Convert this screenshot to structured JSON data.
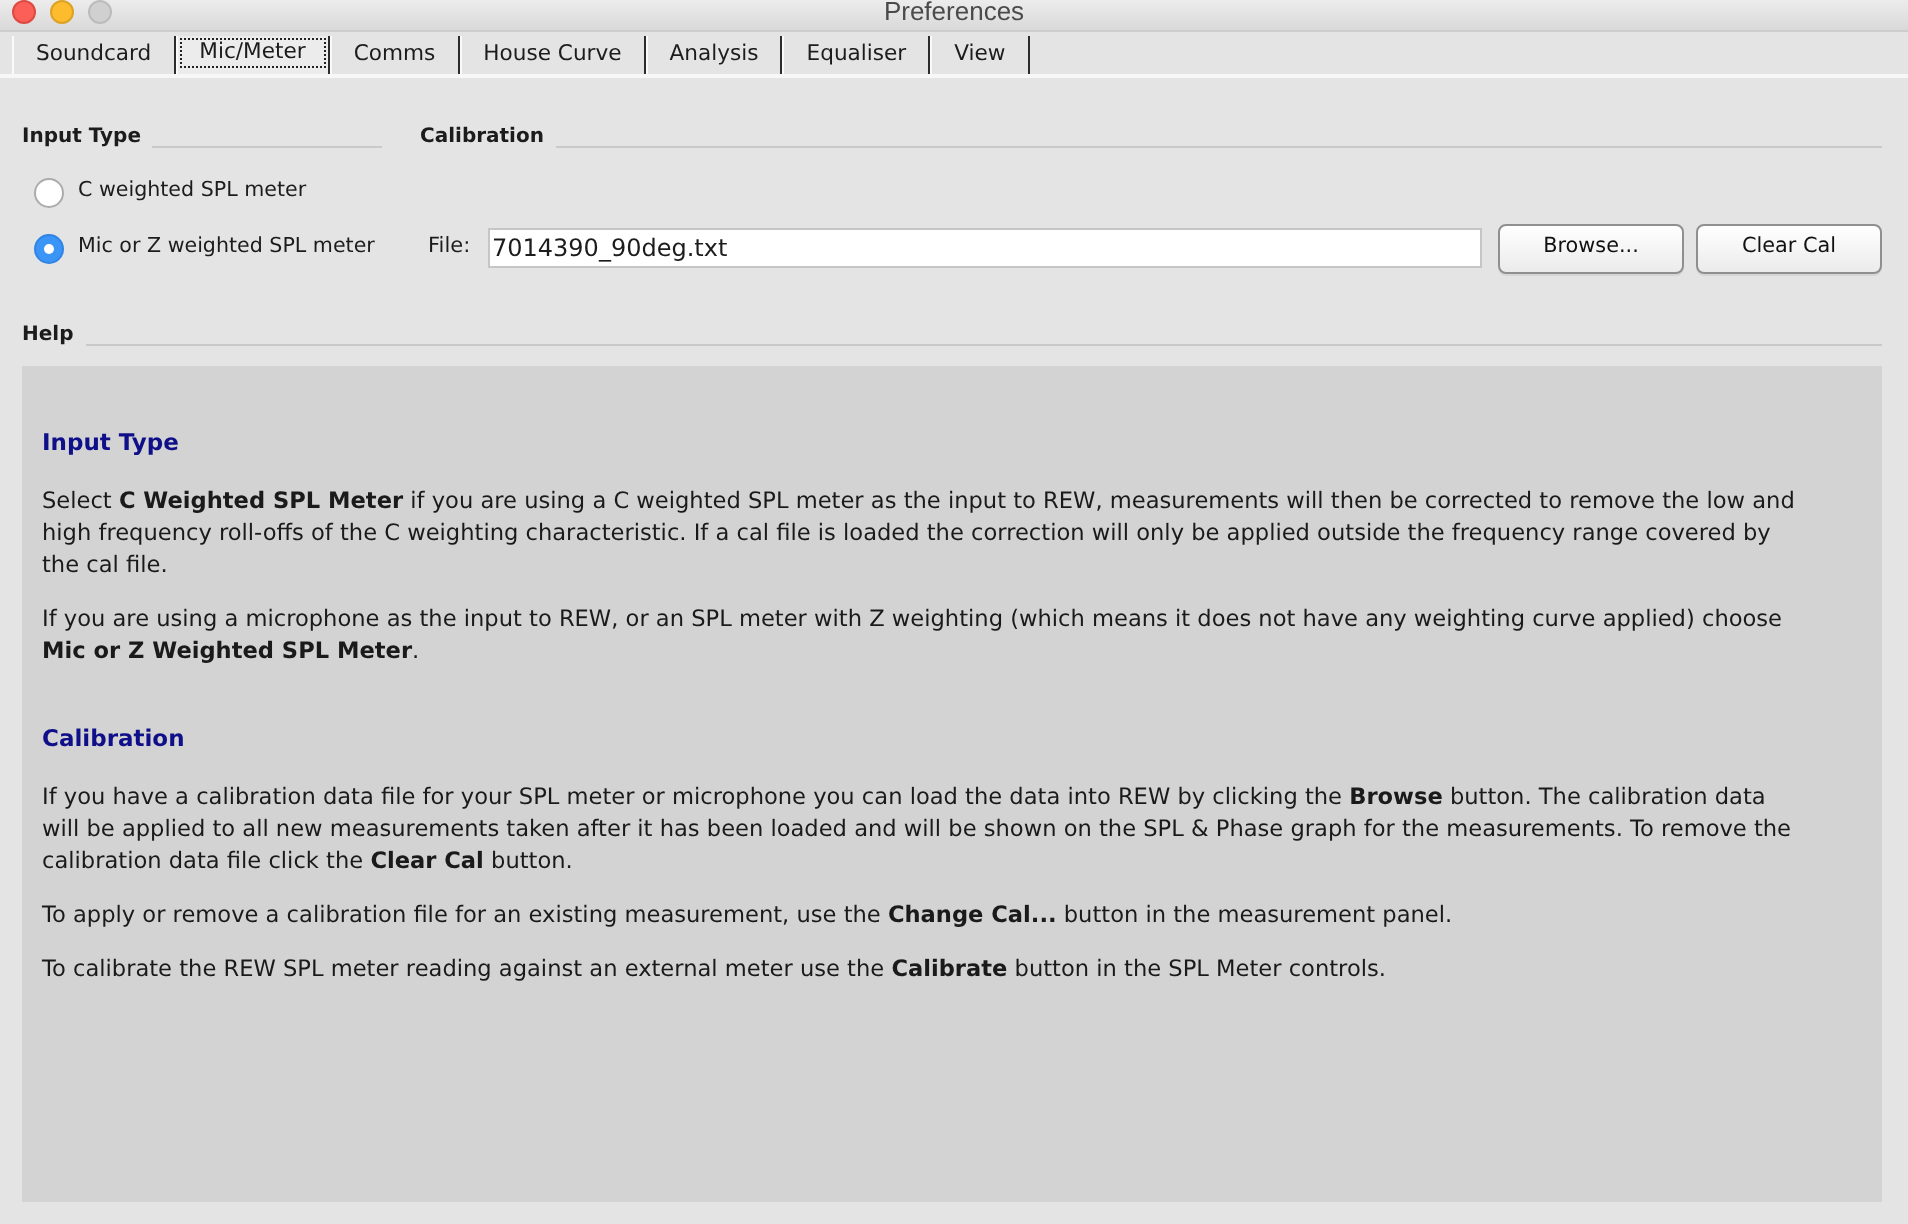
{
  "window": {
    "title": "Preferences"
  },
  "tabs": [
    {
      "label": "Soundcard",
      "selected": false
    },
    {
      "label": "Mic/Meter",
      "selected": true
    },
    {
      "label": "Comms",
      "selected": false
    },
    {
      "label": "House Curve",
      "selected": false
    },
    {
      "label": "Analysis",
      "selected": false
    },
    {
      "label": "Equaliser",
      "selected": false
    },
    {
      "label": "View",
      "selected": false
    }
  ],
  "input_type": {
    "title": "Input Type",
    "options": [
      {
        "label": "C weighted SPL meter",
        "selected": false
      },
      {
        "label": "Mic or Z weighted SPL meter",
        "selected": true
      }
    ]
  },
  "calibration": {
    "title": "Calibration",
    "file_label": "File:",
    "file_value": "7014390_90deg.txt",
    "buttons": [
      "Browse...",
      "Clear Cal"
    ]
  },
  "help": {
    "title": "Help",
    "sections": [
      {
        "heading": "Input Type",
        "paragraphs": [
          "Select **C Weighted SPL Meter** if you are using a C weighted SPL meter as the input to REW, measurements will then be corrected to remove the low and high frequency roll-offs of the C weighting characteristic. If a cal file is loaded the correction will only be applied outside the frequency range covered by the cal file.",
          "If you are using a microphone as the input to REW, or an SPL meter with Z weighting (which means it does not have any weighting curve applied) choose **Mic or Z Weighted SPL Meter**."
        ]
      },
      {
        "heading": "Calibration",
        "paragraphs": [
          "If you have a calibration data file for your SPL meter or microphone you can load the data into REW by clicking the **Browse** button. The calibration data will be applied to all new measurements taken after it has been loaded and will be shown on the SPL & Phase graph for the measurements. To remove the calibration data file click the **Clear Cal** button.",
          "To apply or remove a calibration file for an existing measurement, use the **Change Cal...** button in the measurement panel.",
          "To calibrate the REW SPL meter reading against an external meter use the **Calibrate** button in the SPL Meter controls."
        ]
      }
    ]
  }
}
